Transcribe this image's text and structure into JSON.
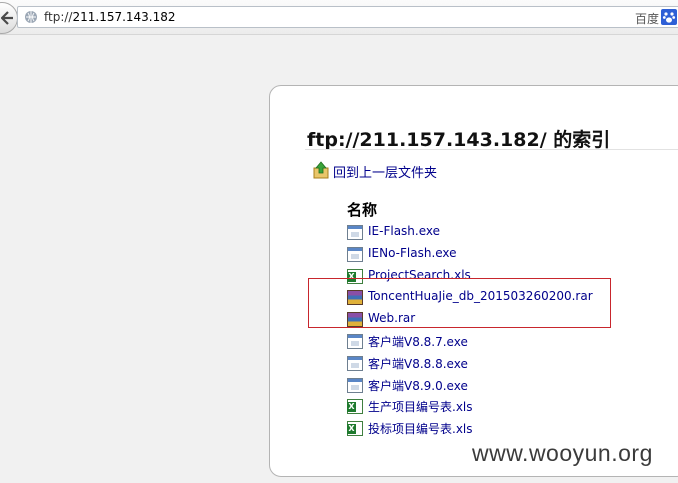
{
  "browser": {
    "url_scheme": "ftp://",
    "url_host": "211.157.143.182",
    "search_engine_label": "百度",
    "icons": {
      "back": "back-arrow-icon",
      "site": "globe-icon",
      "search": "baidu-paw-icon"
    }
  },
  "page": {
    "title": "ftp://211.157.143.182/ 的索引",
    "up_link_label": "回到上一层文件夹",
    "column_header": "名称"
  },
  "files": [
    {
      "name": "IE-Flash.exe",
      "icon": "exe-file-icon"
    },
    {
      "name": "IENo-Flash.exe",
      "icon": "exe-file-icon"
    },
    {
      "name": "ProjectSearch.xls",
      "icon": "excel-file-icon"
    },
    {
      "name": "ToncentHuaJie_db_201503260200.rar",
      "icon": "rar-archive-icon"
    },
    {
      "name": "Web.rar",
      "icon": "rar-archive-icon"
    },
    {
      "name": "客户端V8.8.7.exe",
      "icon": "exe-file-icon"
    },
    {
      "name": "客户端V8.8.8.exe",
      "icon": "exe-file-icon"
    },
    {
      "name": "客户端V8.9.0.exe",
      "icon": "exe-file-icon"
    },
    {
      "name": "生产项目编号表.xls",
      "icon": "excel-file-icon"
    },
    {
      "name": "投标项目编号表.xls",
      "icon": "excel-file-icon"
    }
  ],
  "watermark": "www.wooyun.org",
  "colors": {
    "link": "#00008b",
    "highlight": "#c8262d",
    "background": "#f1f1f1"
  }
}
